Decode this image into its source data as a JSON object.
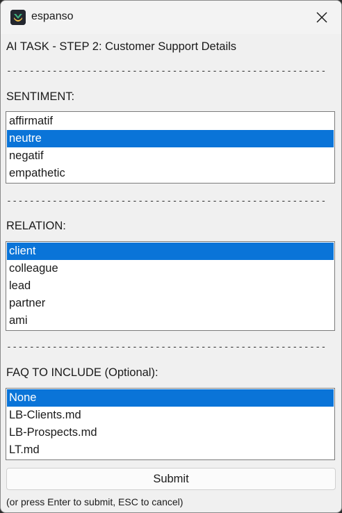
{
  "window": {
    "app_title": "espanso",
    "app_icon": "espanso-logo-icon",
    "close_icon": "close-icon"
  },
  "form": {
    "heading": "AI TASK - STEP 2: Customer Support Details",
    "separator": "--------------------------------------------------------",
    "sentiment": {
      "label": "SENTIMENT:",
      "options": [
        "affirmatif",
        "neutre",
        "negatif",
        "empathetic"
      ],
      "selected_index": 1
    },
    "relation": {
      "label": "RELATION:",
      "options": [
        "client",
        "colleague",
        "lead",
        "partner",
        "ami"
      ],
      "selected_index": 0
    },
    "faq": {
      "label": "FAQ TO INCLUDE (Optional):",
      "options": [
        "None",
        "LB-Clients.md",
        "LB-Prospects.md",
        "LT.md"
      ],
      "selected_index": 0
    },
    "submit_label": "Submit",
    "hint": "(or press Enter to submit, ESC to cancel)"
  },
  "colors": {
    "selection": "#0a74d8",
    "window_bg": "#f0f0f0"
  }
}
